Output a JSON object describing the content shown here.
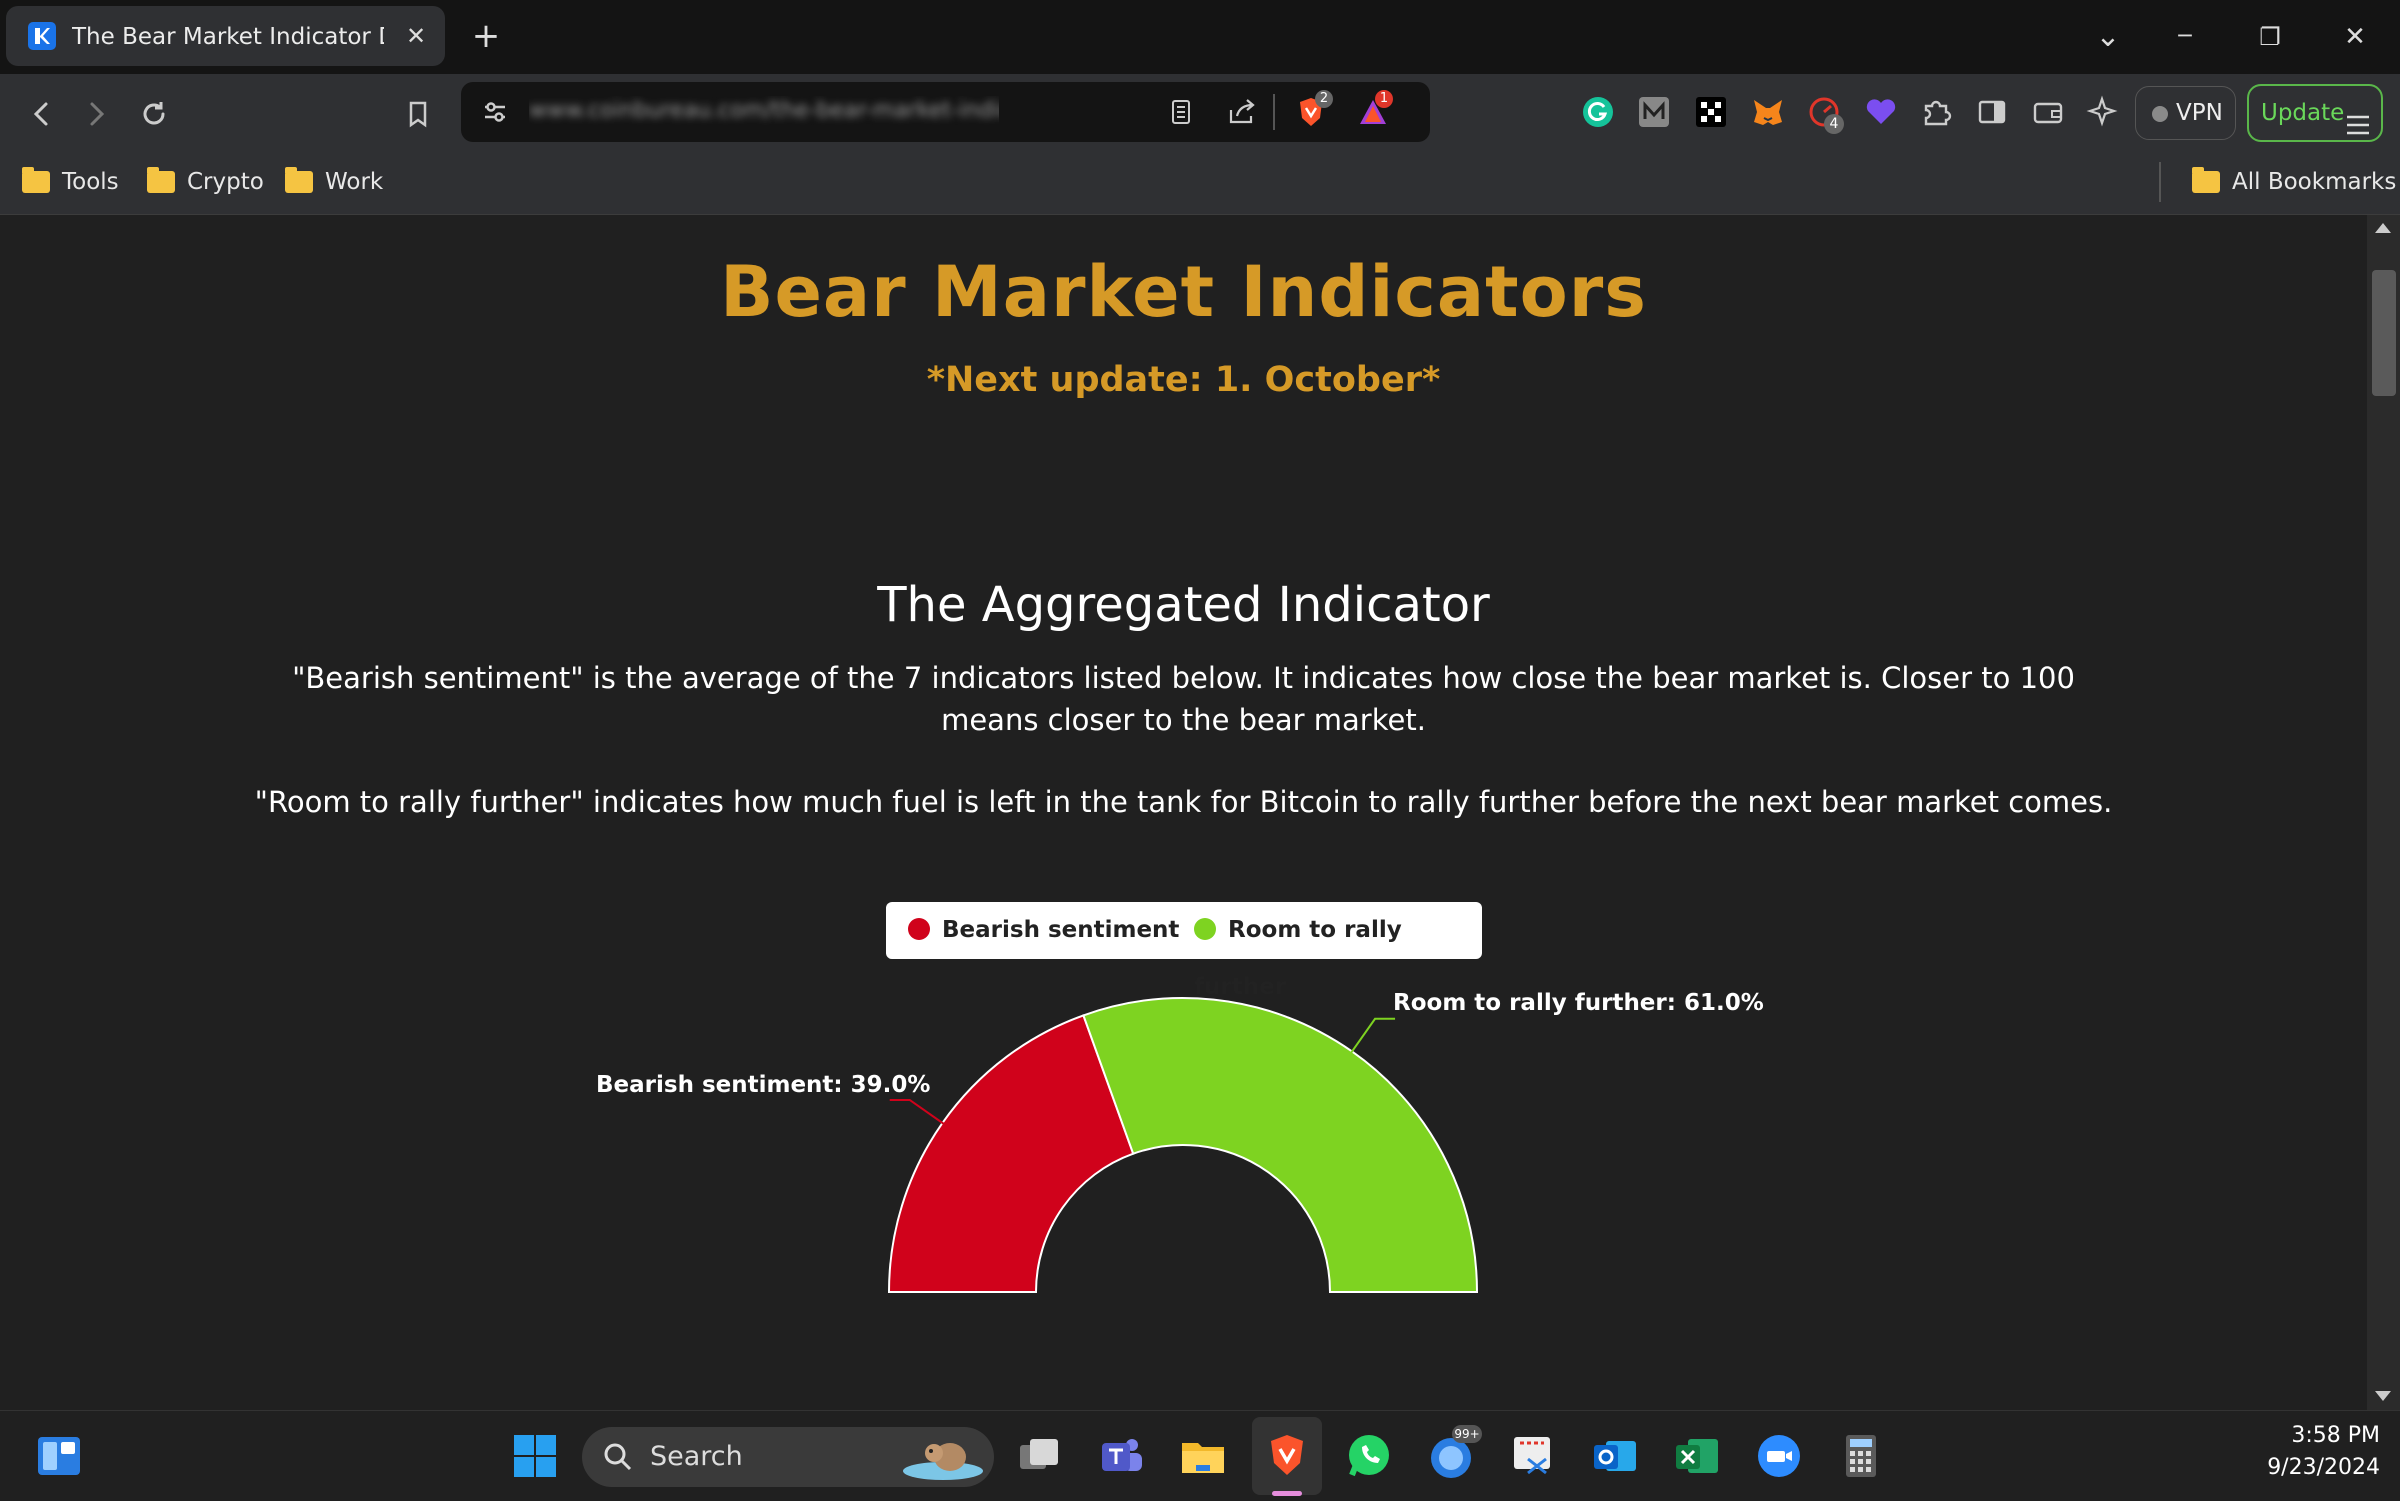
{
  "browser": {
    "tab_title": "The Bear Market Indicator Dashboard",
    "tab_close": "✕",
    "new_tab": "+",
    "window_controls": {
      "tab_search": "⌄",
      "minimize": "─",
      "restore": "❐",
      "close": "✕"
    },
    "url_blurred": "www.coinbureau.com/the-bear-market-indicator",
    "extension_badges": {
      "brave_shields": "2",
      "brave_rewards": "1",
      "speed_ext": "4"
    },
    "vpn_label": "VPN",
    "update_label": "Update",
    "bookmarks": [
      "Tools",
      "Crypto",
      "Work"
    ],
    "all_bookmarks": "All Bookmarks"
  },
  "page": {
    "title": "Bear Market Indicators",
    "next_update": "*Next update: 1. October*",
    "section_title": "The Aggregated Indicator",
    "desc_1": "\"Bearish sentiment\" is the average of the 7 indicators listed below. It indicates how close the bear market is. Closer to 100 means closer to the bear market.",
    "desc_2": "\"Room to rally further\" indicates how much fuel is left in the tank for Bitcoin to rally further before the next bear market comes."
  },
  "chart_data": {
    "type": "pie",
    "variant": "half-doughnut",
    "categories": [
      "Bearish sentiment",
      "Room to rally further"
    ],
    "values": [
      39.0,
      61.0
    ],
    "data_labels": [
      "Bearish sentiment: 39.0%",
      "Room to rally further: 61.0%"
    ],
    "colors": [
      "#d0021b",
      "#7ed321"
    ],
    "legend_position": "top"
  },
  "taskbar": {
    "search_label": "Search",
    "chat_badge": "99+",
    "time": "3:58 PM",
    "date": "9/23/2024"
  }
}
